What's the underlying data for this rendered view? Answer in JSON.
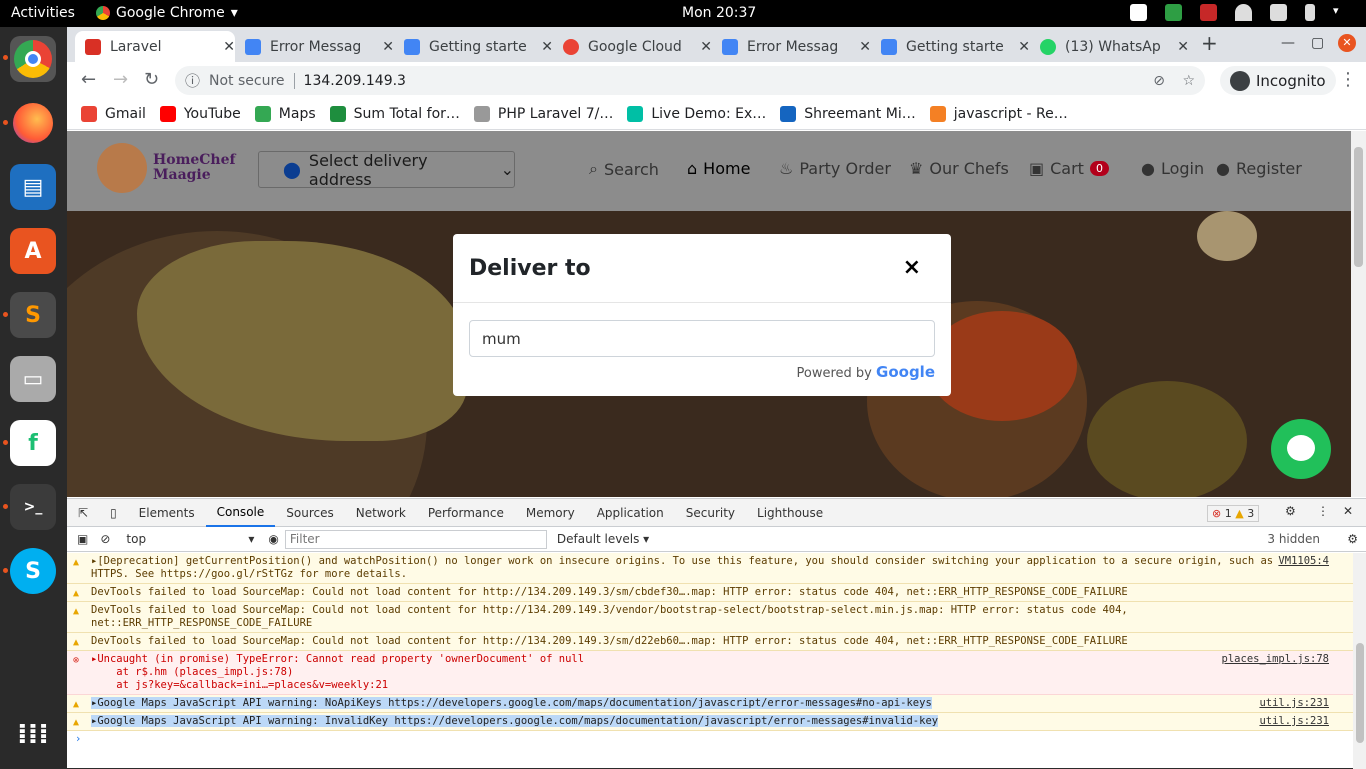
{
  "topbar": {
    "activities": "Activities",
    "app": "Google Chrome",
    "clock": "Mon 20:37"
  },
  "tabs": [
    {
      "title": "Laravel",
      "active": true,
      "color": "#d93025"
    },
    {
      "title": "Error Messag",
      "color": "#4285f4"
    },
    {
      "title": "Getting starte",
      "color": "#4285f4"
    },
    {
      "title": "Google Cloud",
      "color": "#ea4335"
    },
    {
      "title": "Error Messag",
      "color": "#4285f4"
    },
    {
      "title": "Getting starte",
      "color": "#4285f4"
    },
    {
      "title": "(13) WhatsAp",
      "color": "#25d366"
    }
  ],
  "omnibar": {
    "not_secure": "Not secure",
    "url": "134.209.149.3",
    "incognito": "Incognito"
  },
  "bookmarks": [
    {
      "label": "Gmail",
      "color": "#ea4335"
    },
    {
      "label": "YouTube",
      "color": "#ff0000"
    },
    {
      "label": "Maps",
      "color": "#34a853"
    },
    {
      "label": "Sum Total for…",
      "color": "#1e8e3e"
    },
    {
      "label": "PHP Laravel 7/…",
      "color": "#999999"
    },
    {
      "label": "Live Demo: Ex…",
      "color": "#00bfa5"
    },
    {
      "label": "Shreemant Mi…",
      "color": "#1565c0"
    },
    {
      "label": "javascript - Re…",
      "color": "#f48024"
    }
  ],
  "site": {
    "logo": "HomeChef Maagie",
    "address_button": "Select delivery address",
    "menu": {
      "search": "Search",
      "home": "Home",
      "party": "Party Order",
      "chefs": "Our Chefs",
      "cart": "Cart",
      "cart_count": "0",
      "login": "Login",
      "register": "Register"
    }
  },
  "modal": {
    "title": "Deliver to",
    "close": "×",
    "input_value": "mum",
    "powered_by": "Powered by",
    "brand": "Google"
  },
  "devtools": {
    "tabs": [
      "Elements",
      "Console",
      "Sources",
      "Network",
      "Performance",
      "Memory",
      "Application",
      "Security",
      "Lighthouse"
    ],
    "errors": "1",
    "warnings": "3",
    "context": "top",
    "filter_placeholder": "Filter",
    "levels": "Default levels",
    "hidden": "3 hidden"
  },
  "console": [
    {
      "type": "warn",
      "text": "▸[Deprecation] getCurrentPosition() and watchPosition() no longer work on insecure origins. To use this feature, you should consider switching your application to a secure origin, such as HTTPS. See https://goo.gl/rStTGz for more details.",
      "src": "VM1105:4"
    },
    {
      "type": "warn",
      "text": "DevTools failed to load SourceMap: Could not load content for http://134.209.149.3/sm/cbdef30….map: HTTP error: status code 404, net::ERR_HTTP_RESPONSE_CODE_FAILURE",
      "src": ""
    },
    {
      "type": "warn",
      "text": "DevTools failed to load SourceMap: Could not load content for http://134.209.149.3/vendor/bootstrap-select/bootstrap-select.min.js.map: HTTP error: status code 404, net::ERR_HTTP_RESPONSE_CODE_FAILURE",
      "src": ""
    },
    {
      "type": "warn",
      "text": "DevTools failed to load SourceMap: Could not load content for http://134.209.149.3/sm/d22eb60….map: HTTP error: status code 404, net::ERR_HTTP_RESPONSE_CODE_FAILURE",
      "src": ""
    },
    {
      "type": "err",
      "text": "▸Uncaught (in promise) TypeError: Cannot read property 'ownerDocument' of null\n    at r$.hm (places_impl.js:78)\n    at js?key=&callback=ini…=places&v=weekly:21",
      "src": "places_impl.js:78"
    },
    {
      "type": "warn",
      "text": "▸Google Maps JavaScript API warning: NoApiKeys https://developers.google.com/maps/documentation/javascript/error-messages#no-api-keys",
      "src": "util.js:231",
      "sel": true
    },
    {
      "type": "warn",
      "text": "▸Google Maps JavaScript API warning: InvalidKey https://developers.google.com/maps/documentation/javascript/error-messages#invalid-key",
      "src": "util.js:231",
      "sel": true
    }
  ]
}
